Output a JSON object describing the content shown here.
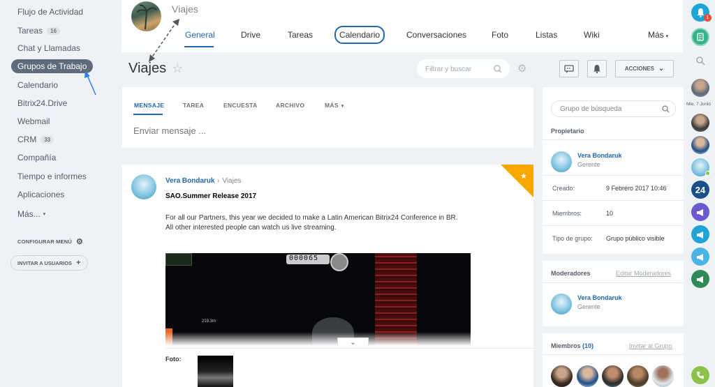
{
  "left_menu": {
    "items": [
      {
        "label": "Flujo de Actividad"
      },
      {
        "label": "Tareas",
        "count": "16"
      },
      {
        "label": "Chat y Llamadas"
      },
      {
        "label": "Grupos de Trabajo"
      },
      {
        "label": "Calendario"
      },
      {
        "label": "Bitrix24.Drive"
      },
      {
        "label": "Webmail"
      },
      {
        "label": "CRM",
        "count": "33"
      },
      {
        "label": "Compañía"
      },
      {
        "label": "Tiempo e informes"
      },
      {
        "label": "Aplicaciones"
      },
      {
        "label": "Más..."
      }
    ],
    "configure_label": "CONFIGURAR MENÚ",
    "invite_label": "INVITAR A USUARIOS"
  },
  "header": {
    "group_name": "Viajes",
    "tabs": [
      {
        "label": "General"
      },
      {
        "label": "Drive"
      },
      {
        "label": "Tareas"
      },
      {
        "label": "Calendario"
      },
      {
        "label": "Conversaciones"
      },
      {
        "label": "Foto"
      },
      {
        "label": "Listas"
      },
      {
        "label": "Wiki"
      },
      {
        "label": "Más"
      }
    ],
    "active_tab": "General"
  },
  "titlebar": {
    "title": "Viajes",
    "search_placeholder": "Filtrar y buscar",
    "actions_label": "ACCIONES"
  },
  "post_form": {
    "tabs": [
      {
        "label": "MENSAJE"
      },
      {
        "label": "TAREA"
      },
      {
        "label": "ENCUESTA"
      },
      {
        "label": "ARCHIVO"
      },
      {
        "label": "MÁS"
      }
    ],
    "placeholder": "Enviar mensaje ..."
  },
  "feed_post": {
    "author": "Vera Bondaruk",
    "destination": "Viajes",
    "title": "SAO.Summer Release 2017",
    "body_line1": "For all our Partners, this year we decided to make a Latin American Bitrix24 Conference in BR.",
    "body_line2": "All other interested people can watch us live streaming.",
    "photo_label": "Foto:",
    "video_counter": "000065",
    "video_distance": "219.3m"
  },
  "right_panel": {
    "search_placeholder": "Grupo de búsqueda",
    "owner_heading": "Propietario",
    "owner_name": "Vera Bondaruk",
    "owner_role": "Gerente",
    "created_label": "Creado:",
    "created_value": "9 Febrero 2017 10:46",
    "members_label": "Miembros:",
    "members_value": "10",
    "type_label": "Tipo de grupo:",
    "type_value": "Grupo público visible",
    "moderators_heading": "Moderadores",
    "edit_moderators": "Editar Moderadores",
    "moderator_name": "Vera Bondaruk",
    "moderator_role": "Gerente",
    "members_heading": "Miembros",
    "members_count": "(10)",
    "invite_group": "Invitar al Grupo"
  },
  "right_bar": {
    "notification_count": "1",
    "date_label": "Mie. 7 Junio"
  },
  "colors": {
    "accent": "#2067b0",
    "active_menu": "#5e6b7a",
    "star_badge": "#f7a700",
    "notify": "#1fa4d7",
    "green": "#8bc34a"
  }
}
